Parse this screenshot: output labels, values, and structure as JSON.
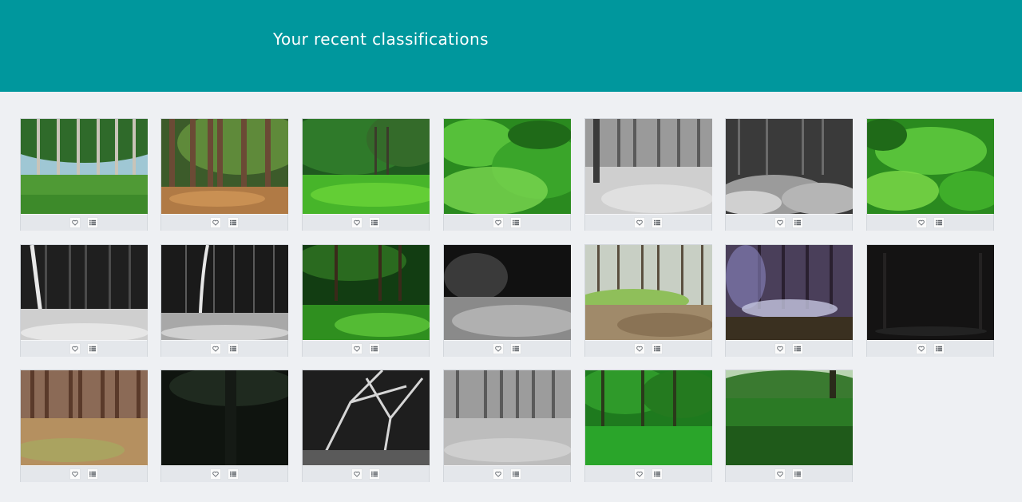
{
  "header": {
    "title": "Your recent classifications"
  },
  "classifications": [
    {
      "scene": "grass-forest",
      "favorite_icon": "heart-icon",
      "collect_icon": "list-icon"
    },
    {
      "scene": "sunny-pines",
      "favorite_icon": "heart-icon",
      "collect_icon": "list-icon"
    },
    {
      "scene": "green-clearing",
      "favorite_icon": "heart-icon",
      "collect_icon": "list-icon"
    },
    {
      "scene": "bright-undergrowth",
      "favorite_icon": "heart-icon",
      "collect_icon": "list-icon"
    },
    {
      "scene": "gray-forest",
      "favorite_icon": "heart-icon",
      "collect_icon": "list-icon"
    },
    {
      "scene": "gray-night-shrubs",
      "favorite_icon": "heart-icon",
      "collect_icon": "list-icon"
    },
    {
      "scene": "bright-undergrowth-2",
      "favorite_icon": "heart-icon",
      "collect_icon": "list-icon"
    },
    {
      "scene": "night-birches",
      "favorite_icon": "heart-icon",
      "collect_icon": "list-icon"
    },
    {
      "scene": "night-thin-trees",
      "favorite_icon": "heart-icon",
      "collect_icon": "list-icon"
    },
    {
      "scene": "shaded-green",
      "favorite_icon": "heart-icon",
      "collect_icon": "list-icon"
    },
    {
      "scene": "night-grass",
      "favorite_icon": "heart-icon",
      "collect_icon": "list-icon"
    },
    {
      "scene": "spring-slope",
      "favorite_icon": "heart-icon",
      "collect_icon": "list-icon"
    },
    {
      "scene": "creek-dusk",
      "favorite_icon": "heart-icon",
      "collect_icon": "list-icon"
    },
    {
      "scene": "dark-night",
      "favorite_icon": "heart-icon",
      "collect_icon": "list-icon"
    },
    {
      "scene": "brown-woods",
      "favorite_icon": "heart-icon",
      "collect_icon": "list-icon"
    },
    {
      "scene": "dark-tree",
      "favorite_icon": "heart-icon",
      "collect_icon": "list-icon"
    },
    {
      "scene": "night-branches",
      "favorite_icon": "heart-icon",
      "collect_icon": "list-icon"
    },
    {
      "scene": "gray-woods",
      "favorite_icon": "heart-icon",
      "collect_icon": "list-icon"
    },
    {
      "scene": "green-grove",
      "favorite_icon": "heart-icon",
      "collect_icon": "list-icon"
    },
    {
      "scene": "meadow-edge",
      "favorite_icon": "heart-icon",
      "collect_icon": "list-icon"
    }
  ],
  "colors": {
    "header": "#00979d",
    "background": "#eef0f3"
  }
}
